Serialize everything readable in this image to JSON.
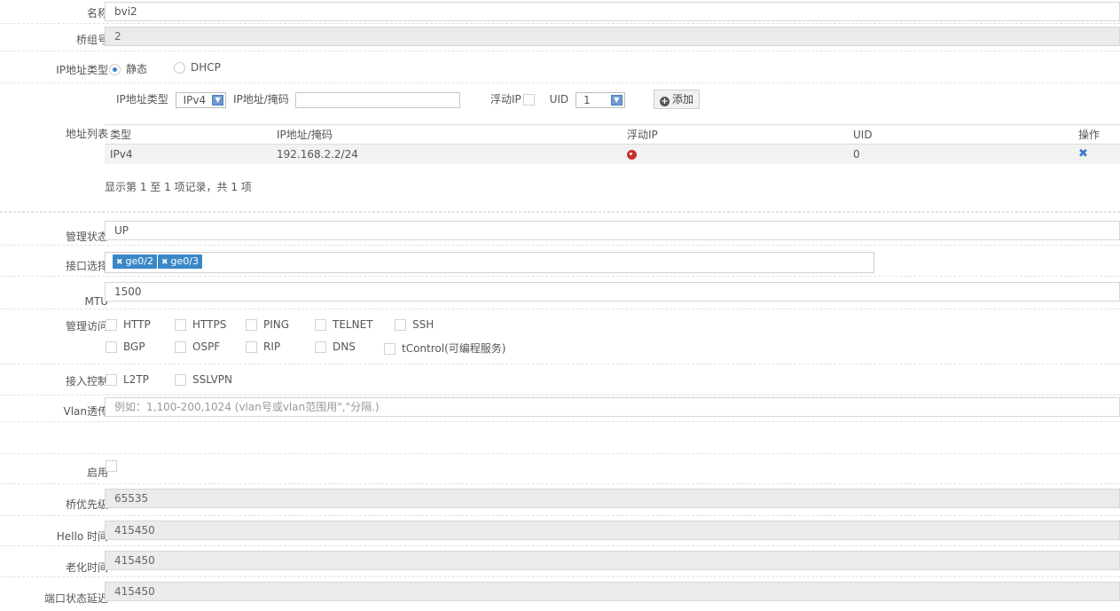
{
  "name": {
    "label": "名称",
    "value": "bvi2"
  },
  "bridge_group": {
    "label": "桥组号",
    "value": "2"
  },
  "ip_type": {
    "label": "IP地址类型",
    "options": [
      "静态",
      "DHCP"
    ],
    "selected": "静态"
  },
  "address_form": {
    "ip_type_label": "IP地址类型",
    "ip_type_value": "IPv4",
    "ip_mask_label": "IP地址/掩码",
    "floating_ip_label": "浮动IP",
    "uid_label": "UID",
    "uid_value": "1",
    "add_label": "添加"
  },
  "address_list": {
    "label": "地址列表",
    "columns": [
      "类型",
      "IP地址/掩码",
      "浮动IP",
      "UID",
      "操作"
    ],
    "rows": [
      {
        "type": "IPv4",
        "ip": "192.168.2.2/24",
        "uid": "0"
      }
    ],
    "summary": "显示第 1 至 1 项记录，共 1 项"
  },
  "admin_status": {
    "label": "管理状态",
    "value": "UP"
  },
  "interfaces": {
    "label": "接口选择",
    "tags": [
      "ge0/2",
      "ge0/3"
    ]
  },
  "mtu": {
    "label": "MTU",
    "value": "1500"
  },
  "mgmt_access": {
    "label": "管理访问",
    "row1": [
      "HTTP",
      "HTTPS",
      "PING",
      "TELNET",
      "SSH"
    ],
    "row2": [
      "BGP",
      "OSPF",
      "RIP",
      "DNS",
      "tControl(可编程服务)"
    ]
  },
  "access_control": {
    "label": "接入控制",
    "options": [
      "L2TP",
      "SSLVPN"
    ]
  },
  "vlan": {
    "label": "Vlan透传",
    "placeholder": "例如：1,100-200,1024 (vlan号或vlan范围用\",\"分隔.)"
  },
  "enable": {
    "label": "启用"
  },
  "bridge_priority": {
    "label": "桥优先级",
    "value": "65535"
  },
  "hello_time": {
    "label": "Hello 时间",
    "value": "415450"
  },
  "aging_time": {
    "label": "老化时间",
    "value": "415450"
  },
  "port_delay": {
    "label": "端口状态延迟",
    "value": "415450"
  },
  "colors": {
    "accent": "#3a87c8",
    "readonly_bg": "#ebebeb",
    "delete_red": "#c9302c"
  }
}
